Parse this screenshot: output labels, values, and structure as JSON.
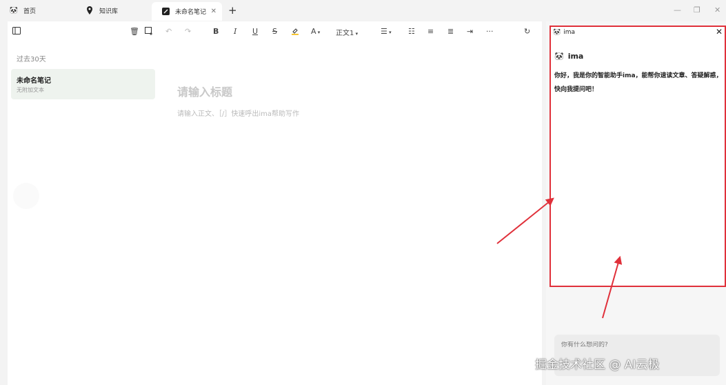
{
  "tabs": [
    {
      "label": "首页",
      "icon": "panda-icon"
    },
    {
      "label": "知识库",
      "icon": "location-pin-icon"
    },
    {
      "label": "未命名笔记",
      "icon": "note-icon",
      "active": true
    }
  ],
  "toolbar": {
    "paragraph_style": "正文1"
  },
  "sidebar": {
    "section_label": "过去30天",
    "notes": [
      {
        "title": "未命名笔记",
        "subtitle": "无附加文本"
      }
    ]
  },
  "editor": {
    "title_placeholder": "请输入标题",
    "body_placeholder": "请输入正文、［/］快速呼出ima帮助写作"
  },
  "assistant": {
    "header_title": "ima",
    "bot_name": "ima",
    "greeting": "你好，我是你的智能助手ima，能帮你速读文章、答疑解惑，快向我提问吧！",
    "input_placeholder": "你有什么想问的?"
  },
  "watermark": "掘金技术社区 @ AI云极",
  "colors": {
    "highlight_border": "#e0303a",
    "note_card_bg": "#eef3ee",
    "arrow": "#e0303a"
  }
}
